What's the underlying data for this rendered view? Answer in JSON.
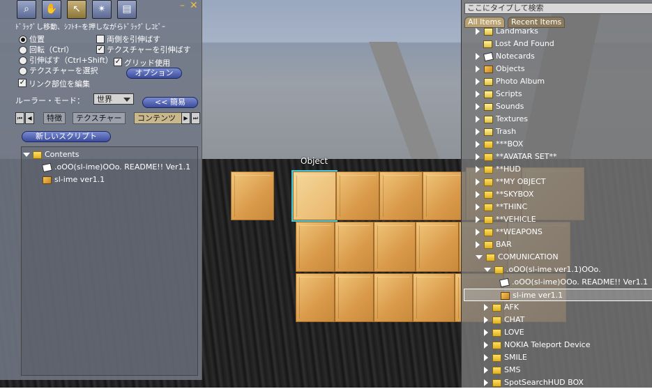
{
  "scene": {
    "object_label": "Object"
  },
  "build": {
    "tools": [
      "zoom-icon",
      "grab-hand-icon",
      "pointer-icon",
      "magic-wand-icon",
      "land-icon"
    ],
    "hint": "ﾄﾞﾗｯｸﾞし移動、ｼﾌﾄｷｰを押しながらﾄﾞﾗｯｸﾞしｺﾋﾟｰ",
    "radio_options": [
      "位置",
      "回転（Ctrl）",
      "引伸ばす（Ctrl+Shift）",
      "テクスチャーを選択"
    ],
    "checks": {
      "stretch_both": "両側を引伸ばす",
      "stretch_textures": "テクスチャーを引伸ばす",
      "use_grid": "グリッド使用",
      "edit_linked": "リンク部位を編集"
    },
    "options_button": "オプション",
    "ruler_label": "ルーラー・モード：",
    "ruler_value": "世界",
    "simple_button": "<< 簡易",
    "tabs": [
      "特徴",
      "テクスチャー",
      "コンテンツ"
    ],
    "new_script_button": "新しいスクリプト",
    "contents": {
      "root": "Contents",
      "items": [
        {
          "name": ".oOO(sl-ime)OOo.  README!! Ver1.1",
          "icon": "notecard-icon"
        },
        {
          "name": "sl-ime ver1.1",
          "icon": "object-icon"
        }
      ]
    }
  },
  "inventory": {
    "search_placeholder": "ここにタイプして検索",
    "tabs": [
      "All Items",
      "Recent Items"
    ],
    "items": [
      {
        "name": "Landmarks",
        "icon": "landmark-icon",
        "level": 0
      },
      {
        "name": "Lost And Found",
        "icon": "lost-found-icon",
        "level": 0,
        "noarrow": true
      },
      {
        "name": "Notecards",
        "icon": "notecard-icon",
        "level": 0
      },
      {
        "name": "Objects",
        "icon": "object-icon",
        "level": 0
      },
      {
        "name": "Photo Album",
        "icon": "photo-icon",
        "level": 0
      },
      {
        "name": "Scripts",
        "icon": "script-icon",
        "level": 0
      },
      {
        "name": "Sounds",
        "icon": "sound-icon",
        "level": 0
      },
      {
        "name": "Textures",
        "icon": "texture-icon",
        "level": 0
      },
      {
        "name": "Trash",
        "icon": "trash-icon",
        "level": 0
      },
      {
        "name": "***BOX",
        "icon": "folder-icon",
        "level": 0
      },
      {
        "name": "**AVATAR SET**",
        "icon": "folder-icon",
        "level": 0
      },
      {
        "name": "**HUD",
        "icon": "folder-icon",
        "level": 0
      },
      {
        "name": "**MY OBJECT",
        "icon": "folder-icon",
        "level": 0
      },
      {
        "name": "**SKYBOX",
        "icon": "folder-icon",
        "level": 0
      },
      {
        "name": "**THINC",
        "icon": "folder-icon",
        "level": 0
      },
      {
        "name": "**VEHICLE",
        "icon": "folder-icon",
        "level": 0
      },
      {
        "name": "**WEAPONS",
        "icon": "folder-icon",
        "level": 0
      },
      {
        "name": "BAR",
        "icon": "folder-icon",
        "level": 0
      },
      {
        "name": "COMUNICATION",
        "icon": "folder-icon",
        "level": 0,
        "open": true
      },
      {
        "name": ".oOO(sl-ime ver1.1)OOo.",
        "icon": "folder-icon",
        "level": 1,
        "open": true
      },
      {
        "name": ".oOO(sl-ime)OOo.  README!! Ver1.1",
        "icon": "notecard-icon",
        "level": 2,
        "noarrow": true
      },
      {
        "name": "sl-ime ver1.1",
        "icon": "object-icon",
        "level": 2,
        "noarrow": true,
        "selected": true
      },
      {
        "name": "AFK",
        "icon": "folder-icon",
        "level": 1
      },
      {
        "name": "CHAT",
        "icon": "folder-icon",
        "level": 1
      },
      {
        "name": "LOVE",
        "icon": "folder-icon",
        "level": 1
      },
      {
        "name": "NOKIA Teleport Device",
        "icon": "folder-icon",
        "level": 1
      },
      {
        "name": "SMILE",
        "icon": "folder-icon",
        "level": 1
      },
      {
        "name": "SMS",
        "icon": "folder-icon",
        "level": 1
      },
      {
        "name": "SpotSearchHUD BOX",
        "icon": "folder-icon",
        "level": 1
      }
    ]
  }
}
